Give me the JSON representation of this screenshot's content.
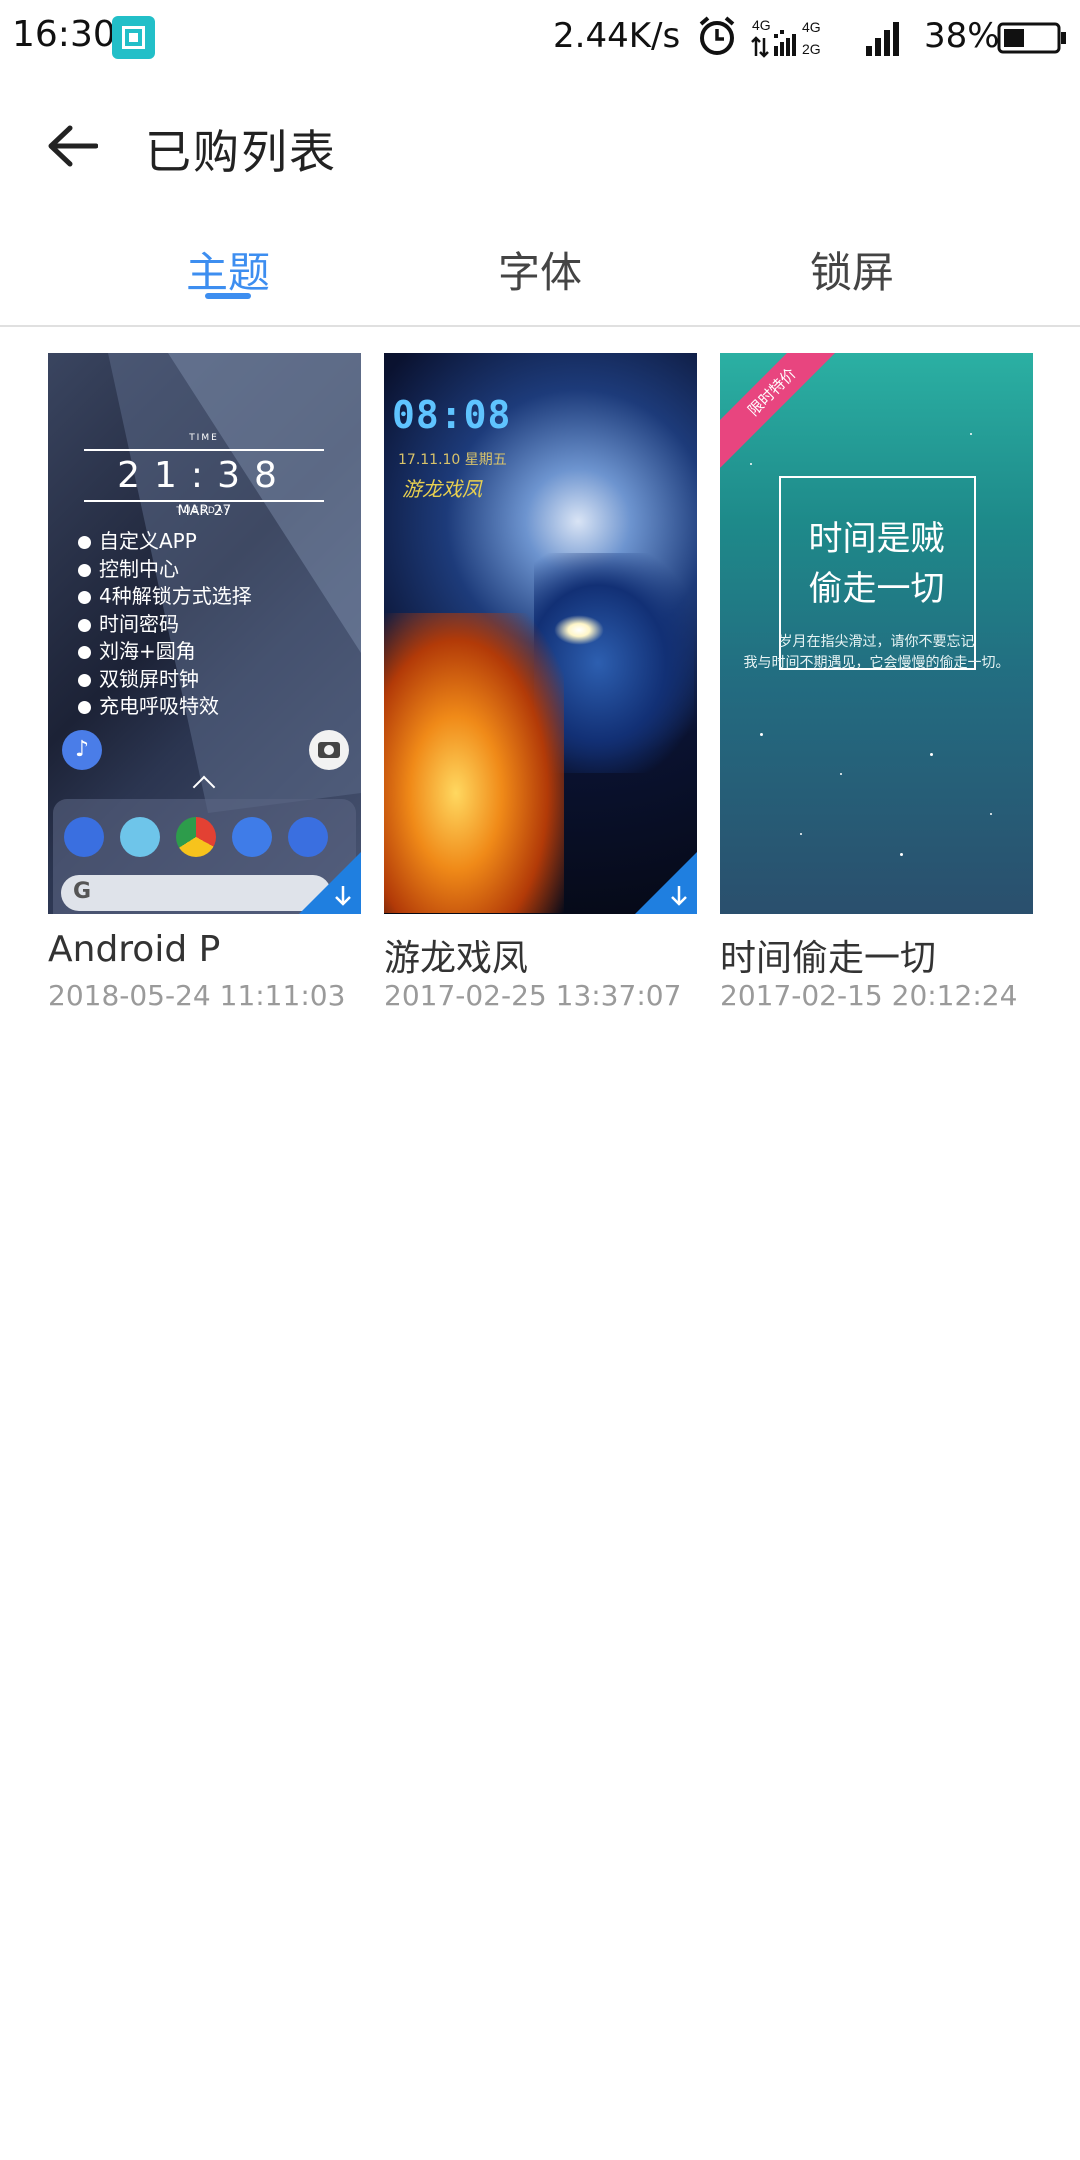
{
  "status_bar": {
    "time": "16:30",
    "net_speed": "2.44K/s",
    "battery": "38%",
    "net1_top": "4G",
    "net2_top": "4G",
    "net2_bottom": "2G",
    "icons": [
      "screen-capture-icon",
      "alarm-icon",
      "network-4g-icon",
      "signal-icon",
      "battery-icon"
    ]
  },
  "header": {
    "title": "已购列表"
  },
  "tabs": [
    {
      "label": "主题",
      "active": true
    },
    {
      "label": "字体",
      "active": false
    },
    {
      "label": "锁屏",
      "active": false
    }
  ],
  "items": [
    {
      "name": "Android P",
      "date": "2018-05-24 11:11:03",
      "preview": {
        "time_label": "TIME",
        "time": "21:38",
        "day": "TUESDAY",
        "date": "MAR 27",
        "features": [
          "自定义APP",
          "控制中心",
          "4种解锁方式选择",
          "时间密码",
          "刘海+圆角",
          "双锁屏时钟",
          "充电呼吸特效"
        ],
        "search_logo": "G"
      }
    },
    {
      "name": "游龙戏凤",
      "date": "2017-02-25 13:37:07",
      "preview": {
        "time": "08:08",
        "subline": "17.11.10 星期五",
        "title": "游龙戏凤"
      }
    },
    {
      "name": "时间偷走一切",
      "date": "2017-02-15 20:12:24",
      "preview": {
        "ribbon": "限时特价",
        "line1": "时间是贼",
        "line2": "偷走一切",
        "sub1": "岁月在指尖滑过，请你不要忘记",
        "sub2": "我与时间不期遇见，它会慢慢的偷走一切。"
      }
    }
  ],
  "colors": {
    "accent": "#3d8ef0",
    "ribbon": "#e8457f",
    "download_badge": "#1f7fe0"
  }
}
